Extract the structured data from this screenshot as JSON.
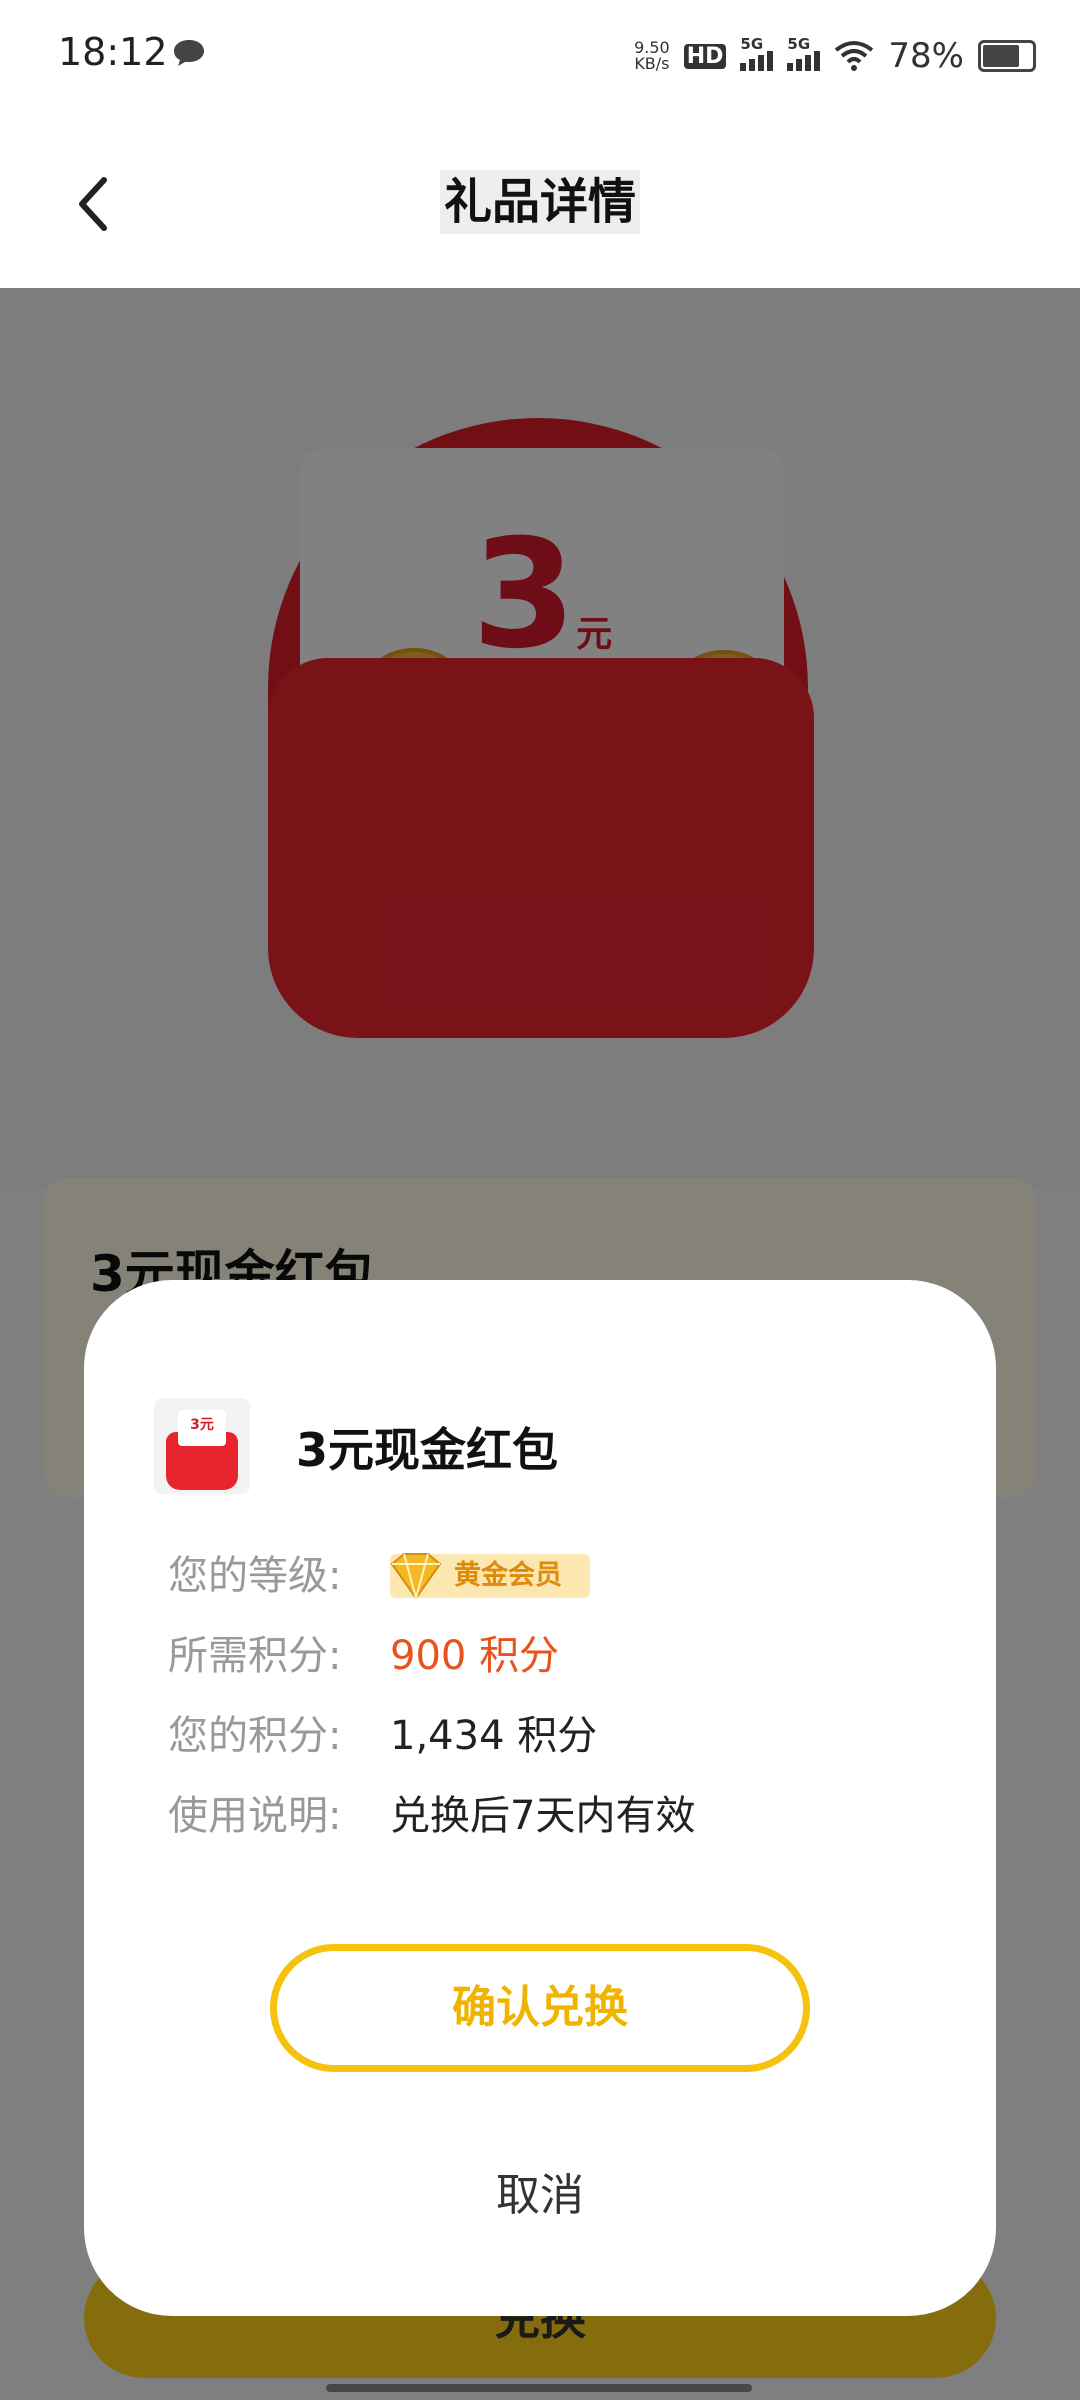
{
  "status_bar": {
    "time": "18:12",
    "net_speed_value": "9.50",
    "net_speed_unit": "KB/s",
    "hd_label": "HD",
    "sim1_label": "5G",
    "sim2_label": "5G",
    "battery_text": "78%",
    "battery_level": 0.78
  },
  "header": {
    "title": "礼品详情"
  },
  "gift": {
    "amount_number": "3",
    "amount_unit": "元",
    "name": "3元现金红包",
    "bottom_button_label": "兑换"
  },
  "dialog": {
    "thumb_text": "3元",
    "title": "3元现金红包",
    "rows": [
      {
        "key": "您的等级:",
        "value": "黄金会员"
      },
      {
        "key": "所需积分:",
        "value": "900 积分"
      },
      {
        "key": "您的积分:",
        "value": "1,434 积分"
      },
      {
        "key": "使用说明:",
        "value": "兑换后7天内有效"
      }
    ],
    "confirm_label": "确认兑换",
    "cancel_label": "取消"
  },
  "colors": {
    "accent_yellow": "#f5c20e",
    "points_orange": "#e8531b",
    "red_envelope": "#e8252f"
  }
}
